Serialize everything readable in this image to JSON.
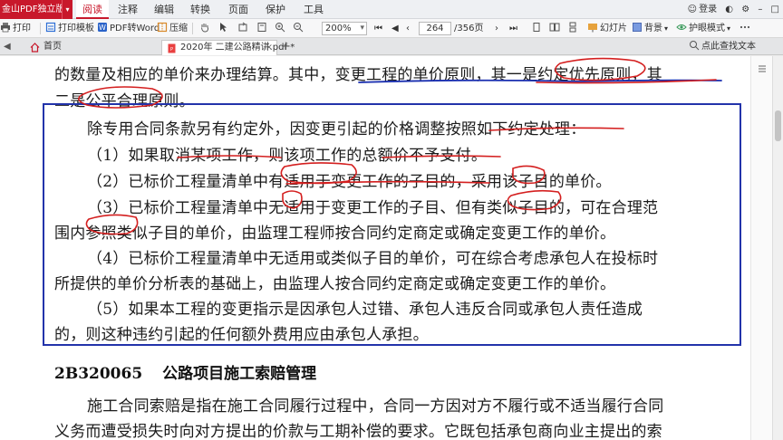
{
  "app": {
    "logo_text": "金山PDF独立版",
    "menu": [
      "阅读",
      "注释",
      "编辑",
      "转换",
      "页面",
      "保护",
      "工具"
    ],
    "active_menu": "阅读",
    "login_label": "登录"
  },
  "toolbar": {
    "print_label": "打印",
    "print_template_label": "打印模板",
    "pdf_to_word_label": "PDF转Word",
    "compress_label": "压缩",
    "zoom_value": "200%",
    "page_current": "264",
    "page_total": "/356页",
    "slideshow_label": "幻灯片",
    "background_label": "背景",
    "eye_label": "护眼模式",
    "select_text_label": "点此查找文本"
  },
  "tabs": {
    "home_label": "首页",
    "doc_label": "2020年 二建公路精讲.pdf *",
    "close_glyph": "×",
    "new_tab_glyph": "+"
  },
  "document": {
    "lines": [
      "的数量及相应的单价来办理结算。其中，变更工程的单价原则，其一是约定优先原则，其",
      "二是公平合理原则。",
      "除专用合同条款另有约定外，因变更引起的价格调整按照如下约定处理：",
      "（1）如果取消某项工作，则该项工作的总额价不予支付。",
      "（2）已标价工程量清单中有适用于变更工作的子目的，采用该子目的单价。",
      "（3）已标价工程量清单中无适用于变更工作的子目、但有类似子目的，可在合理范",
      "围内参照类似子目的单价，由监理工程师按合同约定商定或确定变更工作的单价。",
      "（4）已标价工程量清单中无适用或类似子目的单价，可在综合考虑承包人在投标时",
      "所提供的单价分析表的基础上，由监理人按合同约定商定或确定变更工作的单价。",
      "（5）如果本工程的变更指示是因承包人过错、承包人违反合同或承包人责任造成",
      "的，则这种违约引起的任何额外费用应由承包人承担。",
      "施工合同索赔是指在施工合同履行过程中，合同一方因对方不履行或不适当履行合同",
      "义务而遭受损失时向对方提出的价款与工期补偿的要求。它既包括承包商向业主提出的索"
    ],
    "section_code": "2B320065",
    "section_title": "公路项目施工索赔管理"
  },
  "colors": {
    "brand": "#c8182b",
    "box": "#2233aa",
    "ink_red": "#d41f1f",
    "ink_blue": "#1a2fb0"
  }
}
